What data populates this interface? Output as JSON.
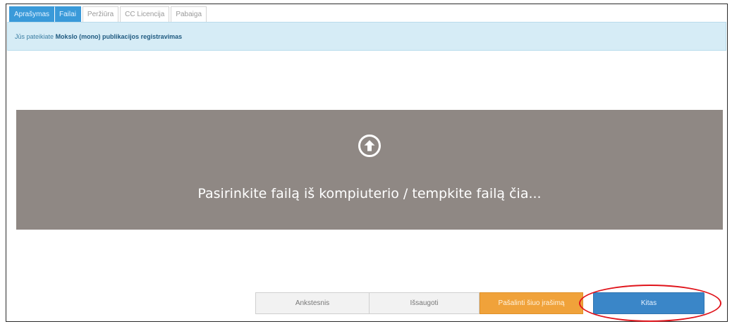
{
  "tabs": [
    {
      "label": "Aprašymas",
      "active": true
    },
    {
      "label": "Failai",
      "active": true
    },
    {
      "label": "Peržiūra",
      "active": false
    },
    {
      "label": "CC Licencija",
      "active": false
    },
    {
      "label": "Pabaiga",
      "active": false
    }
  ],
  "info": {
    "prefix": "Jūs pateikiate",
    "highlight": "Mokslo (mono) publikacijos registravimas"
  },
  "dropzone": {
    "icon": "upload-arrow-icon",
    "text": "Pasirinkite failą iš kompiuterio / tempkite failą čia..."
  },
  "buttons": {
    "previous": "Ankstesnis",
    "save": "Išsaugoti",
    "cancel": "Pašalinti šiuo įrašimą",
    "next": "Kitas"
  },
  "colors": {
    "tab_active": "#3a9ad9",
    "info_bg": "#d6ecf6",
    "dropzone_bg": "#8f8884",
    "cancel_btn": "#f0a23a",
    "next_btn": "#3a86c8",
    "highlight_ring": "#e0141b"
  }
}
